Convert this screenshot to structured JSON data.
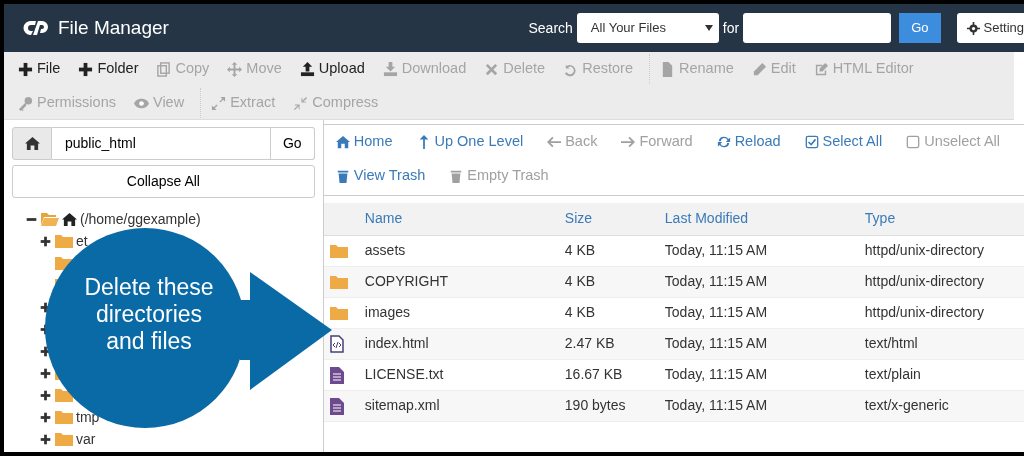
{
  "header": {
    "title": "File Manager",
    "search_label": "Search",
    "scope": "All Your Files",
    "for_label": "for",
    "go": "Go",
    "settings": "Setting"
  },
  "toolbar": {
    "items": [
      {
        "label": "File",
        "disabled": false,
        "divider_before": false
      },
      {
        "label": "Folder",
        "disabled": false,
        "divider_before": false
      },
      {
        "label": "Copy",
        "disabled": true,
        "divider_before": false
      },
      {
        "label": "Move",
        "disabled": true,
        "divider_before": false
      },
      {
        "label": "Upload",
        "disabled": false,
        "divider_before": false
      },
      {
        "label": "Download",
        "disabled": true,
        "divider_before": false
      },
      {
        "label": "Delete",
        "disabled": true,
        "divider_before": false
      },
      {
        "label": "Restore",
        "disabled": true,
        "divider_before": false
      },
      {
        "label": "Rename",
        "disabled": true,
        "divider_before": true
      },
      {
        "label": "Edit",
        "disabled": true,
        "divider_before": false
      },
      {
        "label": "HTML Editor",
        "disabled": true,
        "divider_before": false
      },
      {
        "label": "Permissions",
        "disabled": true,
        "divider_before": false
      },
      {
        "label": "View",
        "disabled": true,
        "divider_before": false
      },
      {
        "label": "Extract",
        "disabled": true,
        "divider_before": true
      },
      {
        "label": "Compress",
        "disabled": true,
        "divider_before": false
      }
    ]
  },
  "path": {
    "value": "public_html",
    "go": "Go"
  },
  "collapse_all": "Collapse All",
  "tree": {
    "label": "(/home/ggexample)",
    "expanded": true,
    "children": [
      {
        "label": "et",
        "expandable": true
      },
      {
        "expandable": false
      },
      {
        "expandable": false
      },
      {
        "expandable": true
      },
      {
        "expandable": true
      },
      {
        "expandable": true
      },
      {
        "expandable": true
      },
      {
        "expandable": true
      },
      {
        "label": "tmp",
        "expandable": true
      },
      {
        "label": "var",
        "expandable": true
      }
    ]
  },
  "nav": {
    "rows": [
      [
        {
          "label": "Home",
          "disabled": false
        },
        {
          "label": "Up One Level",
          "disabled": false
        },
        {
          "label": "Back",
          "disabled": true
        },
        {
          "label": "Forward",
          "disabled": true
        },
        {
          "label": "Reload",
          "disabled": false
        },
        {
          "label": "Select All",
          "disabled": false
        },
        {
          "label": "Unselect All",
          "disabled": true
        }
      ],
      [
        {
          "label": "View Trash",
          "disabled": false
        },
        {
          "label": "Empty Trash",
          "disabled": true
        }
      ]
    ]
  },
  "table": {
    "columns": [
      "Name",
      "Size",
      "Last Modified",
      "Type"
    ],
    "rows": [
      {
        "kind": "folder",
        "name": "assets",
        "size": "4 KB",
        "modified": "Today, 11:15 AM",
        "type": "httpd/unix-directory"
      },
      {
        "kind": "folder",
        "name": "COPYRIGHT",
        "size": "4 KB",
        "modified": "Today, 11:15 AM",
        "type": "httpd/unix-directory"
      },
      {
        "kind": "folder",
        "name": "images",
        "size": "4 KB",
        "modified": "Today, 11:15 AM",
        "type": "httpd/unix-directory"
      },
      {
        "kind": "code",
        "name": "index.html",
        "size": "2.47 KB",
        "modified": "Today, 11:15 AM",
        "type": "text/html"
      },
      {
        "kind": "text",
        "name": "LICENSE.txt",
        "size": "16.67 KB",
        "modified": "Today, 11:15 AM",
        "type": "text/plain"
      },
      {
        "kind": "text",
        "name": "sitemap.xml",
        "size": "190 bytes",
        "modified": "Today, 11:15 AM",
        "type": "text/x-generic"
      }
    ]
  },
  "callout": {
    "text": "Delete these directories and files"
  }
}
